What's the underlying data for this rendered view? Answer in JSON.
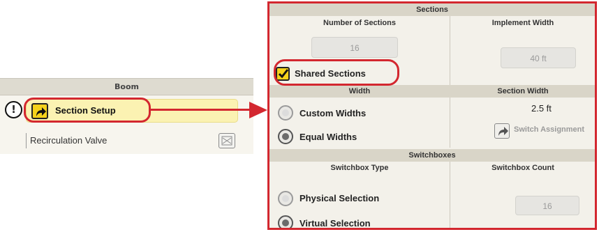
{
  "boom": {
    "header": "Boom",
    "section_setup_label": "Section Setup",
    "recirculation_label": "Recirculation Valve"
  },
  "sections": {
    "header": "Sections",
    "number_of_sections_header": "Number of Sections",
    "number_of_sections_value": "16",
    "implement_width_header": "Implement Width",
    "implement_width_value": "40 ft",
    "shared_sections_label": "Shared Sections",
    "shared_sections_checked": true,
    "width_header": "Width",
    "section_width_header": "Section Width",
    "custom_widths_label": "Custom Widths",
    "equal_widths_label": "Equal Widths",
    "selected_width_mode": "Equal Widths",
    "section_width_value": "2.5 ft",
    "switch_assignment_label": "Switch Assignment"
  },
  "switchboxes": {
    "header": "Switchboxes",
    "type_header": "Switchbox Type",
    "count_header": "Switchbox Count",
    "physical_label": "Physical Selection",
    "virtual_label": "Virtual Selection",
    "selected_type": "Virtual Selection",
    "count_value": "16"
  },
  "colors": {
    "callout_red": "#d3272f",
    "accent_yellow": "#f5d21b",
    "highlight_row": "#fbf2b2"
  },
  "icons": [
    "warning-icon",
    "go-to-page-arrow-icon",
    "recirculation-valve-icon",
    "checkmark-icon",
    "switch-assignment-arrow-icon"
  ]
}
